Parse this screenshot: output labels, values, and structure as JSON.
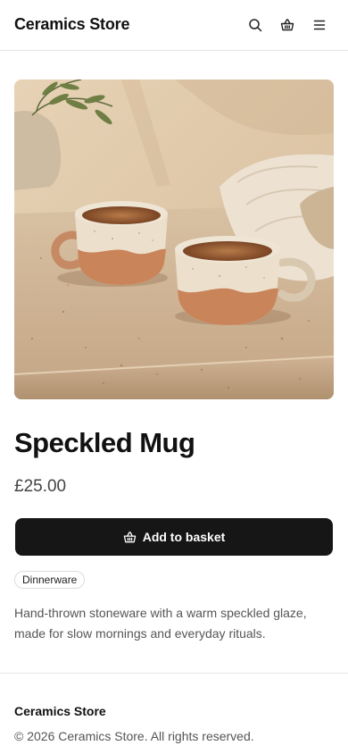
{
  "header": {
    "logo": "Ceramics Store",
    "icons": [
      "search-icon",
      "basket-icon",
      "menu-icon"
    ]
  },
  "product": {
    "title": "Speckled Mug",
    "price": "£25.00",
    "add_label": "Add to basket",
    "tag": "Dinnerware",
    "description": "Hand-thrown stoneware with a warm speckled glaze, made for slow mornings and everyday rituals."
  },
  "footer": {
    "name": "Ceramics Store",
    "copyright": "© 2026 Ceramics Store. All rights reserved."
  },
  "colors": {
    "button_bg": "#161616",
    "text": "#111111",
    "muted": "#555555",
    "divider": "#e5e5e5"
  }
}
